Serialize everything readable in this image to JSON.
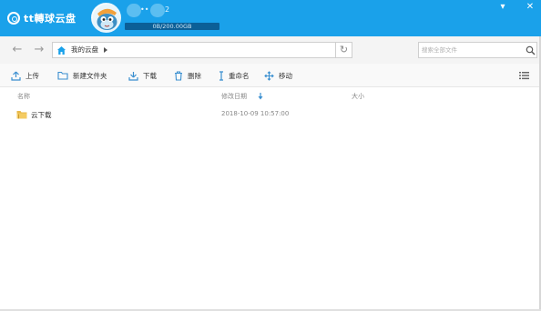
{
  "app": {
    "title": "tt轉球云盘",
    "brand_color": "#1aa1ea",
    "icon": "cloud-logo-icon"
  },
  "user": {
    "name": "••",
    "name_suffix": "2",
    "avatar_icon": "cartoon-fish-avatar",
    "quota": "0B/200.00GB",
    "quota_used_fraction": 0
  },
  "window": {
    "minimize_icon": "minimize-icon",
    "close_icon": "close-icon",
    "minimize_glyph": "▾",
    "close_glyph": "✕"
  },
  "nav": {
    "back_glyph": "←",
    "forward_glyph": "→",
    "path": "我的云盘",
    "refresh_glyph": "↻",
    "search_placeholder": "搜索全部文件"
  },
  "toolbar": {
    "upload": "上传",
    "new_folder": "新建文件夹",
    "download": "下载",
    "delete": "删除",
    "rename": "重命名",
    "move": "移动"
  },
  "columns": {
    "name": "名称",
    "date": "修改日期",
    "size": "大小"
  },
  "files": [
    {
      "name": "云下载",
      "date": "2018-10-09 10:57:00",
      "size": "",
      "icon": "folder-icon"
    }
  ]
}
